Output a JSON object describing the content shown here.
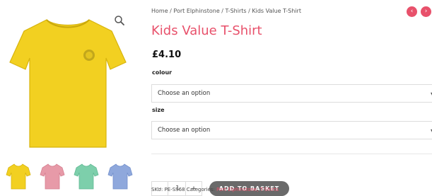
{
  "breadcrumb": {
    "items": [
      "Home",
      "Port Elphinstone",
      "T-Shirts",
      "Kids Value T-Shirt"
    ],
    "separator": "/"
  },
  "product": {
    "title": "Kids Value T-Shirt",
    "price": "£4.10",
    "accent_color": "#e8516b"
  },
  "options": {
    "colour": {
      "label": "colour",
      "placeholder": "Choose an option"
    },
    "size": {
      "label": "size",
      "placeholder": "Choose an option"
    }
  },
  "purchase": {
    "minus": "-",
    "quantity": "1",
    "plus": "+",
    "add_to_basket": "ADD TO BASKET"
  },
  "meta": {
    "sku_label": "SKU:",
    "sku": "PE-SS68",
    "categories_label": "Categories:",
    "categories": "Port Elphinstone, T-Shirts"
  },
  "gallery": {
    "thumbnails": [
      {
        "color_name": "yellow",
        "color": "#f2d021"
      },
      {
        "color_name": "pink",
        "color": "#e79aa8"
      },
      {
        "color_name": "mint",
        "color": "#7dcfab"
      },
      {
        "color_name": "blue",
        "color": "#8fa8dc"
      }
    ],
    "main_color": "#f2d021",
    "icons": {
      "zoom": "search-icon"
    }
  },
  "navigation": {
    "prev": "‹",
    "next": "›"
  }
}
